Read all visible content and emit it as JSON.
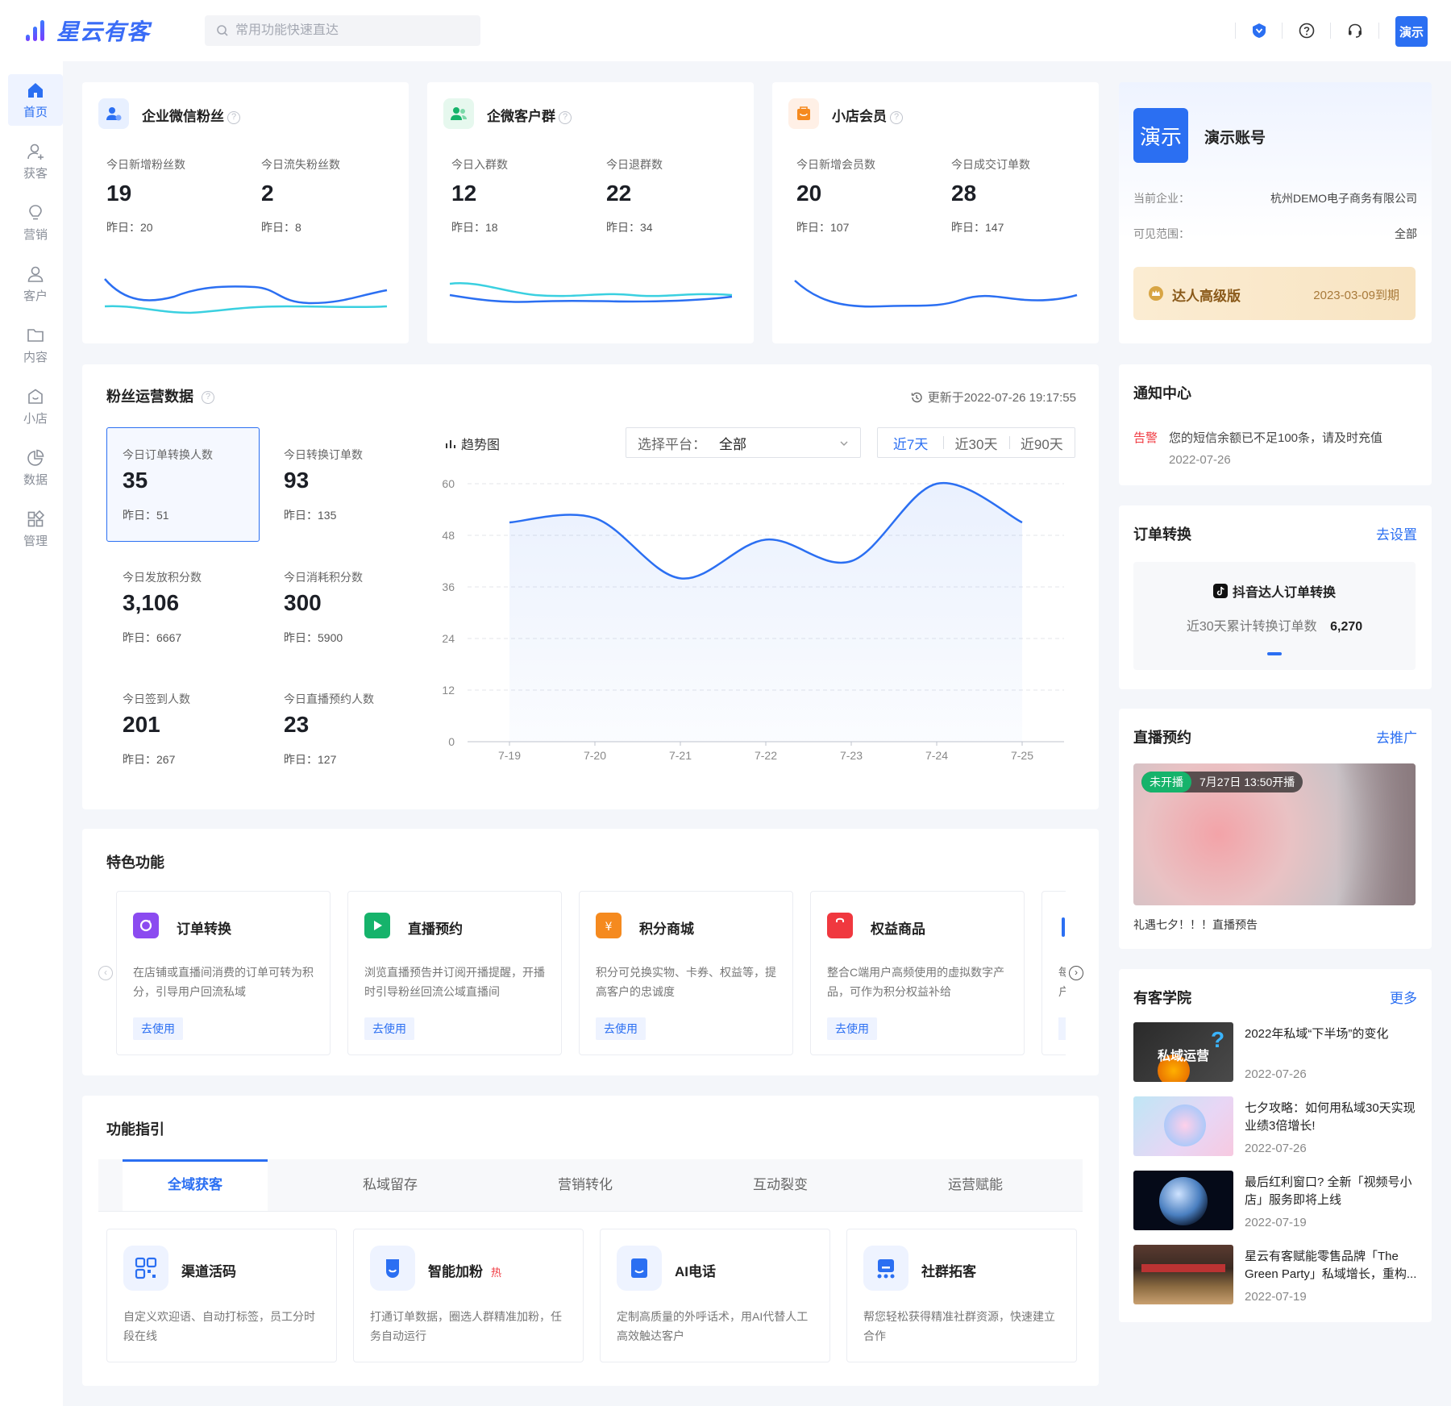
{
  "header": {
    "brand": "星云有客",
    "search_placeholder": "常用功能快速直达",
    "avatar_text": "演示",
    "icons": [
      "shield-icon",
      "help-icon",
      "headset-icon"
    ]
  },
  "sidebar": {
    "items": [
      {
        "label": "首页",
        "icon": "home-icon",
        "active": true
      },
      {
        "label": "获客",
        "icon": "user-add-icon"
      },
      {
        "label": "营销",
        "icon": "bulb-icon"
      },
      {
        "label": "客户",
        "icon": "user-icon"
      },
      {
        "label": "内容",
        "icon": "folder-icon"
      },
      {
        "label": "小店",
        "icon": "shop-icon"
      },
      {
        "label": "数据",
        "icon": "pie-icon"
      },
      {
        "label": "管理",
        "icon": "grid-icon"
      }
    ]
  },
  "summary_cards": [
    {
      "title": "企业微信粉丝",
      "icon": "wechat-fans-icon",
      "stats": [
        {
          "label": "今日新增粉丝数",
          "value": "19",
          "prev": "昨日：20"
        },
        {
          "label": "今日流失粉丝数",
          "value": "2",
          "prev": "昨日：8"
        }
      ]
    },
    {
      "title": "企微客户群",
      "icon": "group-icon",
      "stats": [
        {
          "label": "今日入群数",
          "value": "12",
          "prev": "昨日：18"
        },
        {
          "label": "今日退群数",
          "value": "22",
          "prev": "昨日：34"
        }
      ]
    },
    {
      "title": "小店会员",
      "icon": "member-icon",
      "stats": [
        {
          "label": "今日新增会员数",
          "value": "20",
          "prev": "昨日：107"
        },
        {
          "label": "今日成交订单数",
          "value": "28",
          "prev": "昨日：147"
        }
      ]
    }
  ],
  "fans_ops": {
    "title": "粉丝运营数据",
    "updated": "更新于2022-07-26 19:17:55",
    "trend_label": "趋势图",
    "platform_label": "选择平台：",
    "platform_value": "全部",
    "ranges": [
      "近7天",
      "近30天",
      "近90天"
    ],
    "active_range": "近7天",
    "stats": [
      {
        "label": "今日订单转换人数",
        "value": "35",
        "prev": "昨日：51"
      },
      {
        "label": "今日转换订单数",
        "value": "93",
        "prev": "昨日：135"
      },
      {
        "label": "今日发放积分数",
        "value": "3,106",
        "prev": "昨日：6667"
      },
      {
        "label": "今日消耗积分数",
        "value": "300",
        "prev": "昨日：5900"
      },
      {
        "label": "今日签到人数",
        "value": "201",
        "prev": "昨日：267"
      },
      {
        "label": "今日直播预约人数",
        "value": "23",
        "prev": "昨日：127"
      }
    ]
  },
  "chart_data": {
    "type": "area",
    "title": "",
    "x": [
      "7-19",
      "7-20",
      "7-21",
      "7-22",
      "7-23",
      "7-24",
      "7-25"
    ],
    "series": [
      {
        "values": [
          51,
          52,
          38,
          47,
          42,
          60,
          51
        ]
      }
    ],
    "ylim": [
      0,
      60
    ],
    "yticks": [
      0,
      12,
      24,
      36,
      48,
      60
    ],
    "grid": true,
    "line_color": "#2b6ff2"
  },
  "account": {
    "avatar_text": "演示",
    "name": "演示账号",
    "company_label": "当前企业：",
    "company": "杭州DEMO电子商务有限公司",
    "scope_label": "可见范围：",
    "scope": "全部",
    "plan": "达人高级版",
    "expiry": "2023-03-09到期"
  },
  "notice": {
    "title": "通知中心",
    "tag": "告警",
    "text": "您的短信余额已不足100条，请及时充值",
    "date": "2022-07-26"
  },
  "order_convert": {
    "title": "订单转换",
    "link": "去设置",
    "platform": "抖音达人订单转换",
    "metric_label": "近30天累计转换订单数",
    "metric_value": "6,270"
  },
  "live": {
    "title": "直播预约",
    "link": "去推广",
    "status": "未开播",
    "time": "7月27日 13:50开播",
    "caption": "礼遇七夕！！！直播预告"
  },
  "academy": {
    "title": "有客学院",
    "link": "更多",
    "items": [
      {
        "title": "2022年私域“下半场”的变化",
        "date": "2022-07-26",
        "img_text": "私域运营"
      },
      {
        "title": "七夕攻略：如何用私域30天实现业绩3倍增长!",
        "date": "2022-07-26"
      },
      {
        "title": "最后红利窗口? 全新「视频号小店」服务即将上线",
        "date": "2022-07-19"
      },
      {
        "title": "星云有客赋能零售品牌「The Green Party」私域增长，重构...",
        "date": "2022-07-19"
      }
    ]
  },
  "features": {
    "title": "特色功能",
    "items": [
      {
        "name": "订单转换",
        "desc": "在店铺或直播间消费的订单可转为积分，引导用户回流私域",
        "btn": "去使用",
        "icon": "order-convert-icon",
        "color": "#8b4bf0"
      },
      {
        "name": "直播预约",
        "desc": "浏览直播预告并订阅开播提醒，开播时引导粉丝回流公域直播间",
        "btn": "去使用",
        "icon": "live-icon",
        "color": "#16b36b"
      },
      {
        "name": "积分商城",
        "desc": "积分可兑换实物、卡券、权益等，提高客户的忠诚度",
        "btn": "去使用",
        "icon": "points-mall-icon",
        "color": "#f58a1f"
      },
      {
        "name": "权益商品",
        "desc": "整合C端用户高频使用的虚拟数字产品，可作为积分权益补给",
        "btn": "去使用",
        "icon": "gift-bag-icon",
        "color": "#f0383f"
      }
    ],
    "partial_desc": "每户",
    "nav": [
      "chevron-left-icon",
      "chevron-right-icon"
    ]
  },
  "guide": {
    "title": "功能指引",
    "tabs": [
      "全域获客",
      "私域留存",
      "营销转化",
      "互动裂变",
      "运营赋能"
    ],
    "active_tab": "全域获客",
    "items": [
      {
        "name": "渠道活码",
        "desc": "自定义欢迎语、自动打标签，员工分时段在线",
        "icon": "qrcode-icon"
      },
      {
        "name": "智能加粉",
        "badge": "热",
        "desc": "打通订单数据，圈选人群精准加粉，任务自动运行",
        "icon": "smart-fans-icon"
      },
      {
        "name": "AI电话",
        "desc": "定制高质量的外呼话术，用AI代替人工高效触达客户",
        "icon": "phone-icon"
      },
      {
        "name": "社群拓客",
        "desc": "帮您轻松获得精准社群资源，快速建立合作",
        "icon": "community-icon"
      }
    ]
  }
}
